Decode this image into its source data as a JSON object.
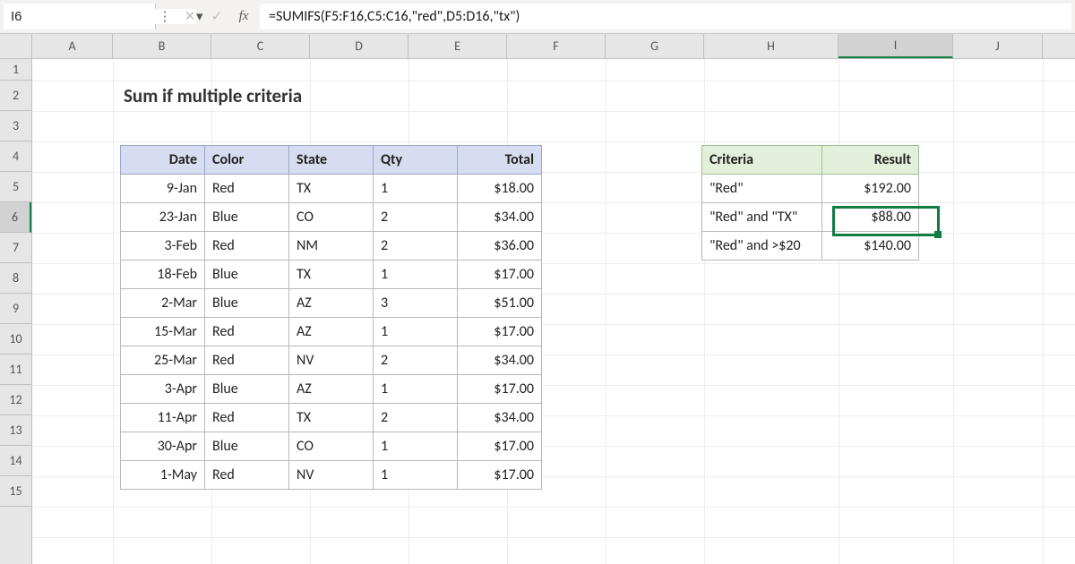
{
  "name_box": "I6",
  "formula": "=SUMIFS(F5:F16,C5:C16,\"red\",D5:D16,\"tx\")",
  "column_labels": [
    "A",
    "B",
    "C",
    "D",
    "E",
    "F",
    "G",
    "H",
    "I",
    "J"
  ],
  "row_labels": [
    "1",
    "2",
    "3",
    "4",
    "5",
    "6",
    "7",
    "8",
    "9",
    "10",
    "11",
    "12",
    "13",
    "14",
    "15"
  ],
  "selected_column_index": 8,
  "selected_row_index": 5,
  "title": "Sum if multiple criteria",
  "data_headers": {
    "date": "Date",
    "color": "Color",
    "state": "State",
    "qty": "Qty",
    "total": "Total"
  },
  "data_rows": [
    {
      "date": "9-Jan",
      "color": "Red",
      "state": "TX",
      "qty": "1",
      "total": "$18.00"
    },
    {
      "date": "23-Jan",
      "color": "Blue",
      "state": "CO",
      "qty": "2",
      "total": "$34.00"
    },
    {
      "date": "3-Feb",
      "color": "Red",
      "state": "NM",
      "qty": "2",
      "total": "$36.00"
    },
    {
      "date": "18-Feb",
      "color": "Blue",
      "state": "TX",
      "qty": "1",
      "total": "$17.00"
    },
    {
      "date": "2-Mar",
      "color": "Blue",
      "state": "AZ",
      "qty": "3",
      "total": "$51.00"
    },
    {
      "date": "15-Mar",
      "color": "Red",
      "state": "AZ",
      "qty": "1",
      "total": "$17.00"
    },
    {
      "date": "25-Mar",
      "color": "Red",
      "state": "NV",
      "qty": "2",
      "total": "$34.00"
    },
    {
      "date": "3-Apr",
      "color": "Blue",
      "state": "AZ",
      "qty": "1",
      "total": "$17.00"
    },
    {
      "date": "11-Apr",
      "color": "Red",
      "state": "TX",
      "qty": "2",
      "total": "$34.00"
    },
    {
      "date": "30-Apr",
      "color": "Blue",
      "state": "CO",
      "qty": "1",
      "total": "$17.00"
    },
    {
      "date": "1-May",
      "color": "Red",
      "state": "NV",
      "qty": "1",
      "total": "$17.00"
    }
  ],
  "criteria_headers": {
    "criteria": "Criteria",
    "result": "Result"
  },
  "criteria_rows": [
    {
      "criteria": "\"Red\"",
      "result": "$192.00"
    },
    {
      "criteria": "\"Red\" and \"TX\"",
      "result": "$88.00"
    },
    {
      "criteria": "\"Red\" and >$20",
      "result": "$140.00"
    }
  ],
  "icons": {
    "more": "⋮",
    "cancel": "✕",
    "enter": "✓",
    "fx": "fx",
    "dropdown": "▾"
  }
}
